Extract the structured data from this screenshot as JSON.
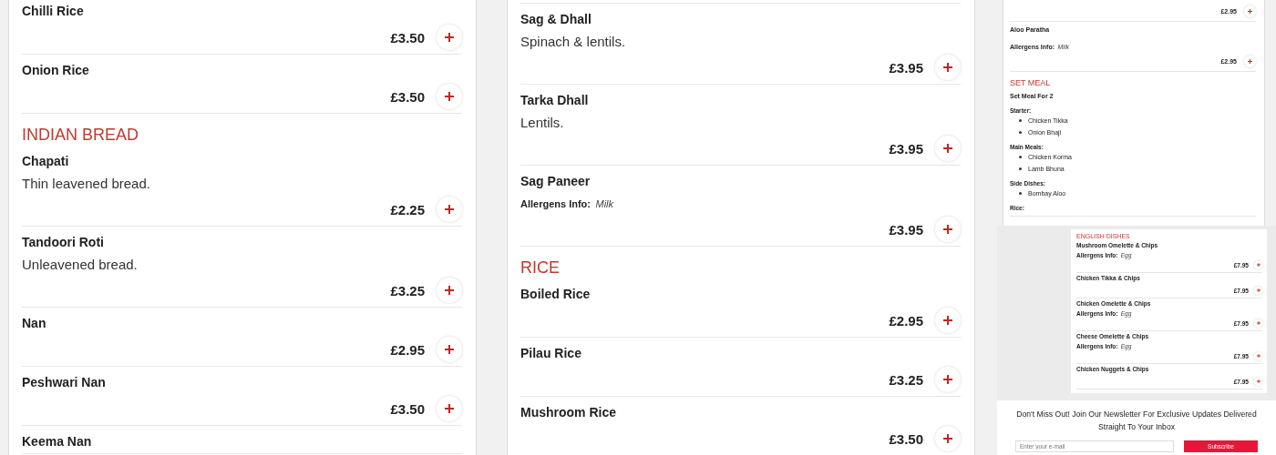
{
  "menu_columns": [
    {
      "sections": [
        {
          "items": [
            {
              "name": "Chilli Rice",
              "price": "£3.50"
            },
            {
              "name": "Onion Rice",
              "price": "£3.50"
            }
          ]
        },
        {
          "heading": "INDIAN BREAD",
          "items": [
            {
              "name": "Chapati",
              "description": "Thin leavened bread.",
              "price": "£2.25"
            },
            {
              "name": "Tandoori Roti",
              "description": "Unleavened bread.",
              "price": "£3.25"
            },
            {
              "name": "Nan",
              "price": "£2.95"
            },
            {
              "name": "Peshwari Nan",
              "price": "£3.50"
            },
            {
              "name": "Keema Nan"
            }
          ]
        }
      ]
    },
    {
      "sections": [
        {
          "items": [
            {
              "name": "Sag & Dhall",
              "description": "Spinach & lentils.",
              "price": "£3.95"
            },
            {
              "name": "Tarka Dhall",
              "description": "Lentils.",
              "price": "£3.95"
            },
            {
              "name": "Sag Paneer",
              "allergens": {
                "label": "Allergens Info:",
                "value": "Milk"
              },
              "price": "£3.95"
            }
          ]
        },
        {
          "heading": "RICE",
          "items": [
            {
              "name": "Boiled Rice",
              "price": "£2.95"
            },
            {
              "name": "Pilau Rice",
              "price": "£3.25"
            },
            {
              "name": "Mushroom Rice",
              "price": "£3.50"
            }
          ]
        }
      ]
    }
  ],
  "sidebar": {
    "top_menu": {
      "sections": [
        {
          "items": [
            {
              "price": "£2.95"
            },
            {
              "name": "Aloo Paratha",
              "allergens": {
                "label": "Allergens Info:",
                "value": "Milk"
              },
              "price": "£2.95"
            }
          ]
        },
        {
          "heading": "SET MEAL",
          "items": [
            {
              "name": "Set Meal For 2",
              "groups": [
                {
                  "label": "Starter:",
                  "items": [
                    "Chicken Tikka",
                    "Onion Bhaji"
                  ]
                },
                {
                  "label": "Main Meals:",
                  "items": [
                    "Chicken Korma",
                    "Lamb Bhuna"
                  ]
                },
                {
                  "label": "Side Dishes:",
                  "items": [
                    "Bombay Aloo"
                  ]
                },
                {
                  "label": "Rice:"
                }
              ]
            }
          ]
        }
      ]
    },
    "inset_menu": {
      "sections": [
        {
          "heading": "ENGLISH DISHES",
          "items": [
            {
              "name": "Mushroom Omelette & Chips",
              "allergens": {
                "label": "Allergens Info:",
                "value": "Egg"
              },
              "price": "£7.95"
            },
            {
              "name": "Chicken Tikka & Chips",
              "price": "£7.95"
            },
            {
              "name": "Chicken Omelette & Chips",
              "allergens": {
                "label": "Allergens Info:",
                "value": "Egg"
              },
              "price": "£7.95"
            },
            {
              "name": "Cheese Omelette & Chips",
              "allergens": {
                "label": "Allergens Info:",
                "value": "Egg"
              },
              "price": "£7.95"
            },
            {
              "name": "Chicken Nuggets & Chips",
              "price": "£7.95"
            }
          ]
        }
      ]
    },
    "newsletter": {
      "text": "Don't Miss Out! Join Our Newsletter For Exclusive Updates Delivered Straight To Your Inbox",
      "placeholder": "Enter your e-mail",
      "button": "Subscribe"
    }
  }
}
